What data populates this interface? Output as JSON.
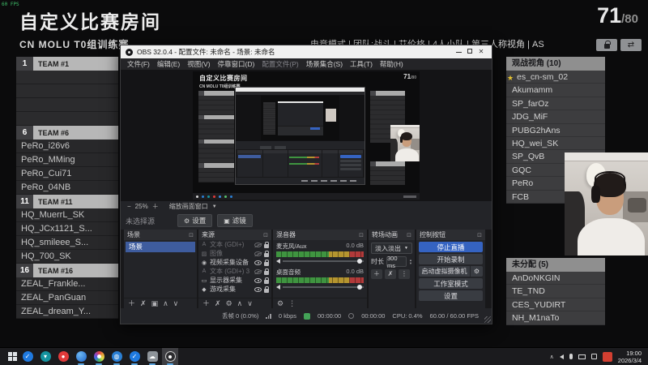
{
  "overlay": {
    "fps": "60 FPS"
  },
  "game": {
    "title": "自定义比赛房间",
    "subtitle": "CN MOLU T0组训练赛",
    "mode_line": "电竞模式 | 团队:战斗 | 艾伦格 | 4人小队 | 第三人称视角 | AS",
    "count_current": "71",
    "count_max": "/80",
    "teams": [
      {
        "num": "1",
        "label": "TEAM #1",
        "players": [
          "",
          "",
          "",
          ""
        ]
      },
      {
        "num": "6",
        "label": "TEAM #6",
        "players": [
          "PeRo_i26v6",
          "PeRo_MMing",
          "PeRo_Cui71",
          "PeRo_04NB"
        ]
      },
      {
        "num": "11",
        "label": "TEAM #11",
        "players": [
          "HQ_MuerrL_SK",
          "HQ_JCx1121_S...",
          "HQ_smileee_S...",
          "HQ_700_SK"
        ]
      },
      {
        "num": "16",
        "label": "TEAM #16",
        "players": [
          "ZEAL_Frankle...",
          "ZEAL_PanGuan",
          "ZEAL_dream_Y..."
        ]
      }
    ],
    "spectators": {
      "header": "观战视角 (10)",
      "names": [
        "es_cn-sm_02",
        "Akumamm",
        "SP_farOz",
        "JDG_MiF",
        "PUBG2hAns",
        "HQ_wei_SK",
        "SP_QvB",
        "GQC",
        "PeRo",
        "FCB"
      ]
    },
    "unassigned": {
      "header": "未分配 (5)",
      "names": [
        "AnDoNKGIN",
        "TE_TND",
        "CES_YUDIRT",
        "NH_M1naTo"
      ]
    }
  },
  "obs": {
    "title": "OBS 32.0.4 - 配置文件: 未命名 - 场景: 未命名",
    "menus": [
      "文件(F)",
      "编辑(E)",
      "视图(V)",
      "停靠窗口(D)",
      "配置文件(P)",
      "场景集合(S)",
      "工具(T)",
      "帮助(H)"
    ],
    "preview_zoom": "25%",
    "preview_fit": "缩放画面窗口",
    "no_source": "未选择源",
    "settings_btn": "设置",
    "filters_btn": "滤镜",
    "docks": {
      "scenes": {
        "header": "场景",
        "items": [
          "场景"
        ]
      },
      "sources": {
        "header": "来源",
        "items": [
          {
            "name": "文本 (GDI+)",
            "visible": false
          },
          {
            "name": "图像",
            "visible": false
          },
          {
            "name": "视频采集设备",
            "visible": true
          },
          {
            "name": "文本 (GDI+) 3",
            "visible": false
          },
          {
            "name": "显示器采集",
            "visible": true
          },
          {
            "name": "游戏采集",
            "visible": true
          }
        ]
      },
      "mixer": {
        "header": "混音器",
        "channels": [
          {
            "name": "麦克风/Aux",
            "db": "0.0 dB"
          },
          {
            "name": "桌面音频",
            "db": "0.0 dB"
          }
        ]
      },
      "transitions": {
        "header": "转场动画",
        "type": "淡入淡出",
        "duration_label": "时长",
        "duration": "300 ms"
      },
      "controls": {
        "header": "控制按钮",
        "buttons": [
          "停止直播",
          "开始录制",
          "启动虚拟摄像机",
          "工作室模式",
          "设置"
        ]
      }
    },
    "statusbar": {
      "dropped": "丢帧 0 (0.0%)",
      "bitrate": "0 kbps",
      "live_time": "00:00:00",
      "rec_time": "00:00:00",
      "cpu": "CPU: 0.4%",
      "fps": "60.00 / 60.00 FPS"
    },
    "colors": {
      "accent_blue": "#3563c1",
      "selected_row": "#3e5c9e",
      "meter_green": "#3f9440",
      "meter_red": "#b23a3a"
    }
  },
  "taskbar": {
    "time": "19:00",
    "date": "2026/3/4"
  }
}
